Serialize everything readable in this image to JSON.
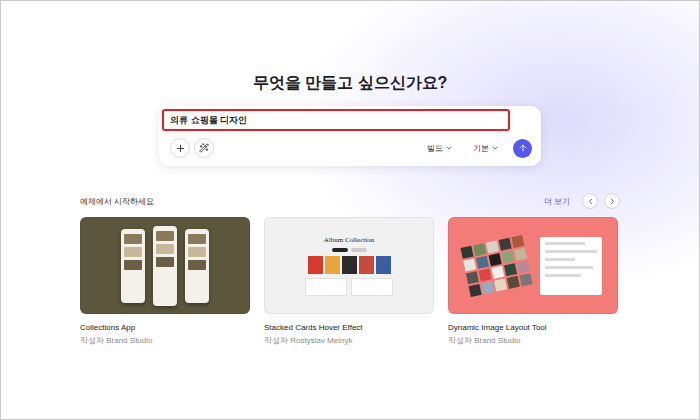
{
  "heading": "무엇을 만들고 싶으신가요?",
  "prompt": {
    "value": "의류 쇼핑몰 디자인",
    "highlighted": true
  },
  "toolbar": {
    "mode": "빌드",
    "model": "기본"
  },
  "examples": {
    "title": "예제에서 시작하세요",
    "more": "더 보기",
    "cards": [
      {
        "title": "Collections App",
        "author": "작성자 Brand Studio",
        "kind": "phones",
        "color": "#5b563c"
      },
      {
        "title": "Stacked Cards Hover Effect",
        "author": "작성자 Rostyslav Melnyk",
        "kind": "albums",
        "color": "#f1f1f1",
        "preview_title": "Album Collection"
      },
      {
        "title": "Dynamic Image Layout Tool",
        "author": "작성자 Brand Studio",
        "kind": "mosaic",
        "color": "#f37b78"
      }
    ]
  }
}
